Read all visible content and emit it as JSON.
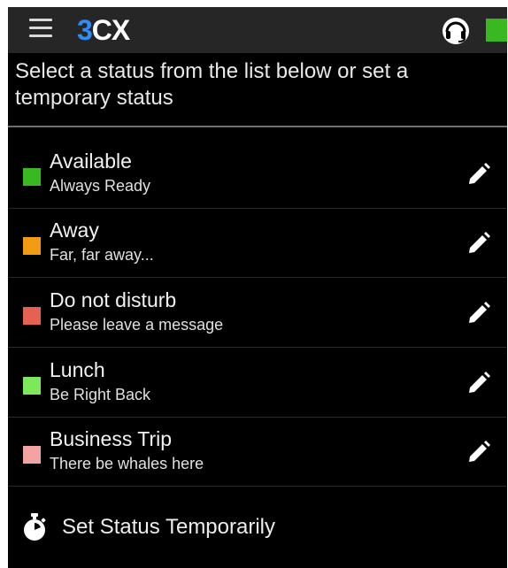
{
  "header": {
    "logo_prefix": "3",
    "logo_suffix": "CX",
    "menu_icon": "hamburger-menu-icon",
    "headset_icon": "headset-icon",
    "current_status_color": "#39b820"
  },
  "intro_text": "Select a status from the list below or set a temporary status",
  "statuses": [
    {
      "name": "Available",
      "description": "Always Ready",
      "color": "#39b820"
    },
    {
      "name": "Away",
      "description": "Far, far away...",
      "color": "#f49b16"
    },
    {
      "name": "Do not disturb",
      "description": "Please leave a message",
      "color": "#e56152"
    },
    {
      "name": "Lunch",
      "description": "Be Right Back",
      "color": "#7de85a"
    },
    {
      "name": "Business Trip",
      "description": "There be whales here",
      "color": "#f4a3a3"
    }
  ],
  "edit_icon": "pencil-edit-icon",
  "temporary": {
    "label": "Set Status Temporarily",
    "icon": "stopwatch-icon"
  }
}
